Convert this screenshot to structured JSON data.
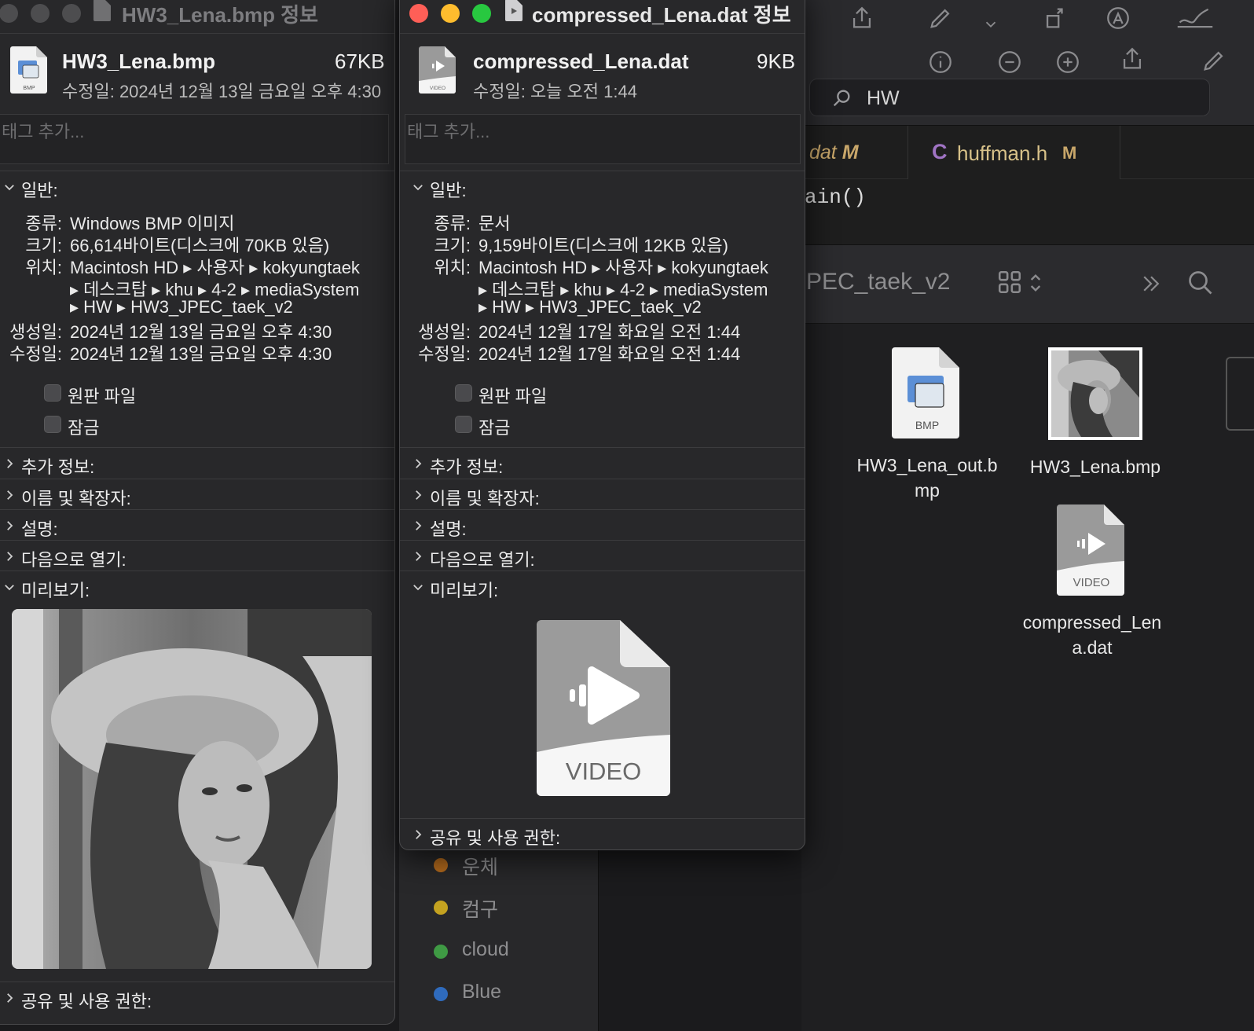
{
  "background_app": {
    "search_query": "HW",
    "tabs": [
      {
        "label": "dat",
        "badge": "M"
      },
      {
        "label": "huffman.h",
        "badge": "M",
        "lang_icon": "C"
      }
    ],
    "code_line": "ain()",
    "folder_title": "PEC_taek_v2",
    "files": [
      {
        "name": "HW3_Lena_out.bmp",
        "line1": "HW3_Lena_out.b",
        "line2": "mp",
        "badge": "BMP"
      },
      {
        "name": "HW3_Lena.bmp"
      },
      {
        "name": "compressed_Lena.dat",
        "line1": "compressed_Len",
        "line2": "a.dat",
        "badge": "VIDEO"
      }
    ],
    "sidebar_tags": [
      {
        "label": "운체",
        "color": "#b46a1d"
      },
      {
        "label": "컴구",
        "color": "#c4a220"
      },
      {
        "label": "cloud",
        "color": "#3f9a44"
      },
      {
        "label": "Blue",
        "color": "#2f6bbd"
      }
    ]
  },
  "window1": {
    "title": "HW3_Lena.bmp 정보",
    "file_name": "HW3_Lena.bmp",
    "file_size": "67KB",
    "modified_header": "수정일: 2024년 12월 13일 금요일 오후 4:30",
    "icon_badge": "BMP",
    "tag_placeholder": "태그 추가...",
    "general_label": "일반:",
    "kind_key": "종류:",
    "kind_val": "Windows BMP 이미지",
    "size_key": "크기:",
    "size_val": "66,614바이트(디스크에 70KB 있음)",
    "where_key": "위치:",
    "where_line1": "Macintosh HD ▸ 사용자 ▸ kokyungtaek",
    "where_line2": "▸ 데스크탑 ▸ khu ▸ 4-2 ▸ mediaSystem",
    "where_line3": "▸ HW ▸ HW3_JPEC_taek_v2",
    "created_key": "생성일:",
    "created_val": "2024년 12월 13일 금요일 오후 4:30",
    "modified_key": "수정일:",
    "modified_val": "2024년 12월 13일 금요일 오후 4:30",
    "stationery_label": "원판 파일",
    "locked_label": "잠금",
    "more_info": "추가 정보:",
    "name_ext": "이름 및 확장자:",
    "comments": "설명:",
    "open_with": "다음으로 열기:",
    "preview": "미리보기:",
    "sharing": "공유 및 사용 권한:"
  },
  "window2": {
    "title": "compressed_Lena.dat 정보",
    "file_name": "compressed_Lena.dat",
    "file_size": "9KB",
    "modified_header": "수정일: 오늘 오전 1:44",
    "icon_badge": "VIDEO",
    "tag_placeholder": "태그 추가...",
    "general_label": "일반:",
    "kind_key": "종류:",
    "kind_val": "문서",
    "size_key": "크기:",
    "size_val": "9,159바이트(디스크에 12KB 있음)",
    "where_key": "위치:",
    "where_line1": "Macintosh HD ▸ 사용자 ▸ kokyungtaek",
    "where_line2": "▸ 데스크탑 ▸ khu ▸ 4-2 ▸ mediaSystem",
    "where_line3": "▸ HW ▸ HW3_JPEC_taek_v2",
    "created_key": "생성일:",
    "created_val": "2024년 12월 17일 화요일 오전 1:44",
    "modified_key": "수정일:",
    "modified_val": "2024년 12월 17일 화요일 오전 1:44",
    "stationery_label": "원판 파일",
    "locked_label": "잠금",
    "more_info": "추가 정보:",
    "name_ext": "이름 및 확장자:",
    "comments": "설명:",
    "open_with": "다음으로 열기:",
    "preview": "미리보기:",
    "preview_badge": "VIDEO",
    "sharing": "공유 및 사용 권한:"
  },
  "colors": {
    "close": "#ff5f57",
    "minimize": "#febc2e",
    "zoom": "#28c840",
    "window_bg": "#28282a"
  }
}
